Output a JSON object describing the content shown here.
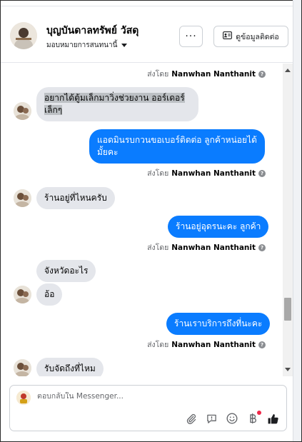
{
  "header": {
    "page_name": "บุญบันดาลทรัพย์ วัสดุ",
    "assign_label": "มอบหมายการสนทนานี้",
    "more_label": "···",
    "contact_label": "ดูข้อมูลติดต่อ"
  },
  "conversation": {
    "sent_by_prefix": "ส่งโดย",
    "agent_name": "Nanwhan Nanthanit",
    "messages": [
      {
        "direction": "in",
        "text": "อยากได้ตู้มเล็กมาวิ่งช่วยงาน ออร์เดอร์เล็กๆ"
      },
      {
        "direction": "out",
        "text": "แอดมินรบกวนขอเบอร์ติดต่อ ลูกค้าหน่อยได้มั้ยคะ"
      },
      {
        "direction": "in",
        "text": "ร้านอยู่ที่ไหนครับ"
      },
      {
        "direction": "out",
        "text": "ร้านอยู่อุดรนะคะ ลูกค้า"
      },
      {
        "direction": "in",
        "text": "จังหวัดอะไร"
      },
      {
        "direction": "in",
        "text": "อ้อ"
      },
      {
        "direction": "out",
        "text": "ร้านเราบริการถึงที่นะคะ"
      },
      {
        "direction": "in",
        "text": "รับจัดถึงที่ไหม"
      }
    ]
  },
  "composer": {
    "placeholder": "ตอบกลับใน Messenger..."
  },
  "colors": {
    "outgoing_bubble": "#0a7cff",
    "incoming_bubble": "#e4e6eb",
    "accent": "#0a7cff",
    "notification_dot": "#f02849"
  },
  "icons": [
    "more-icon",
    "contact-card-icon",
    "chevron-down-icon",
    "info-icon",
    "attachment-icon",
    "saved-replies-icon",
    "emoji-icon",
    "payment-icon",
    "like-icon"
  ]
}
